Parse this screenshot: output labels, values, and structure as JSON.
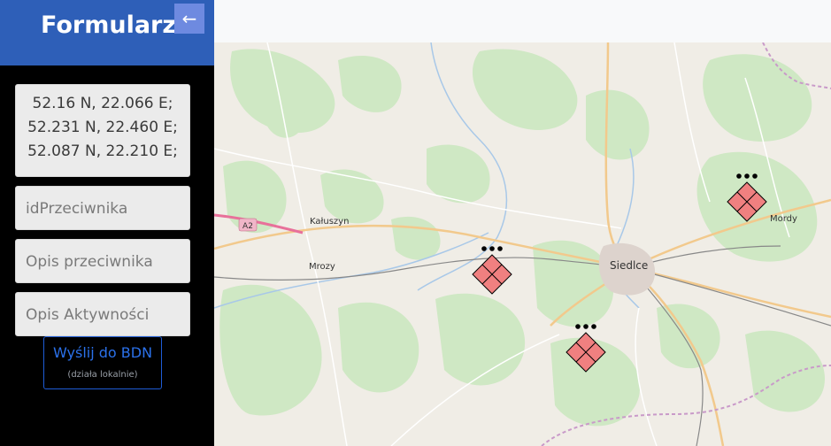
{
  "sidebar": {
    "title": "Formularz",
    "back_icon": "arrow-left-icon",
    "back_glyph": "←",
    "coordinates": [
      "52.16 N, 22.066 E;",
      "52.231 N, 22.460 E;",
      "52.087 N, 22.210 E;"
    ],
    "fields": {
      "id_placeholder": "idPrzeciwnika",
      "opis_placeholder": "Opis przeciwnika",
      "aktywnosc_placeholder": "Opis Aktywności"
    },
    "send_button": {
      "label": "Wyślij do BDN",
      "sublabel": "(działa lokalnie)"
    }
  },
  "map": {
    "road_label": "A2",
    "places": [
      "Kałuszyn",
      "Mrozy",
      "Siedlce",
      "Mordy"
    ],
    "marker_icon": "enemy-unit-diamond-icon",
    "marker_count": 3,
    "marker_color": "#f08080"
  },
  "colors": {
    "header": "#2e5fb8",
    "sidebar_bg": "#000000",
    "button_border": "#1e5cd6"
  }
}
